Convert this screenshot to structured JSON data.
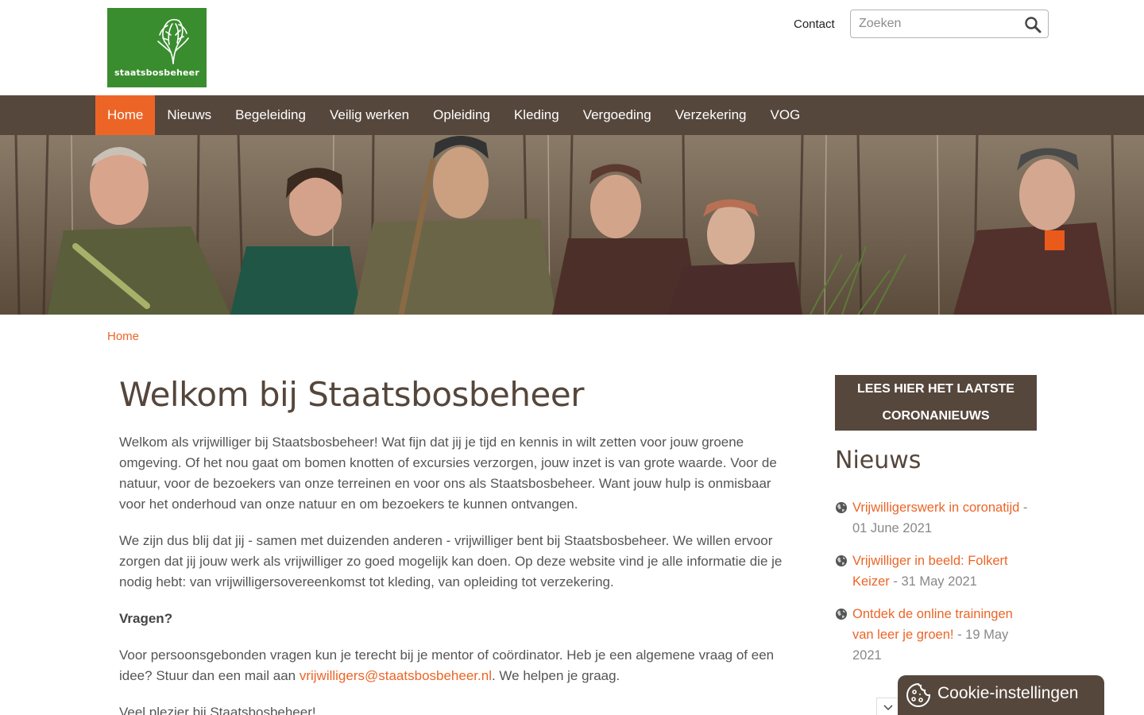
{
  "header": {
    "logo_text": "staatsbosbeheer",
    "contact_label": "Contact",
    "search_placeholder": "Zoeken"
  },
  "nav": {
    "items": [
      "Home",
      "Nieuws",
      "Begeleiding",
      "Veilig werken",
      "Opleiding",
      "Kleding",
      "Vergoeding",
      "Verzekering",
      "VOG"
    ],
    "active": "Home"
  },
  "breadcrumb": "Home",
  "main": {
    "title": "Welkom bij Staatsbosbeheer",
    "p1": "Welkom als vrijwilliger bij Staatsbosbeheer! Wat fijn dat jij je tijd en kennis in wilt zetten voor jouw groene omgeving. Of het nou gaat om bomen knotten of excursies verzorgen, jouw inzet is van grote waarde. Voor de natuur, voor de bezoekers van onze terreinen en voor ons als Staatsbosbeheer. Want jouw hulp is onmisbaar voor het onderhoud van onze natuur en om bezoekers te kunnen ontvangen.",
    "p2": "We zijn dus blij dat jij - samen met duizenden anderen - vrijwilliger bent bij Staatsbosbeheer. We willen ervoor zorgen dat jij jouw werk als vrijwilliger zo goed mogelijk kan doen. Op deze website vind je alle informatie die je nodig hebt: van vrijwilligersovereenkomst tot kleding, van opleiding tot verzekering.",
    "questions_heading": "Vragen?",
    "p3_before": "Voor persoonsgebonden vragen kun je terecht bij je mentor of coördinator. Heb je een algemene vraag of een idee? Stuur dan een mail aan ",
    "p3_email": "vrijwilligers@staatsbosbeheer.nl",
    "p3_after": ". We helpen je graag.",
    "p4": "Veel plezier bij Staatsbosbeheer!"
  },
  "sidebar": {
    "corona_line1": "LEES HIER HET LAATSTE",
    "corona_line2": "CORONANIEUWS",
    "news_heading": "Nieuws",
    "news": [
      {
        "title": "Vrijwilligerswerk in coronatijd",
        "date": "01 June 2021"
      },
      {
        "title": "Vrijwilliger in beeld: Folkert Keizer",
        "date": "31 May 2021"
      },
      {
        "title": "Ontdek de online trainingen van leer je groen!",
        "date": "19 May 2021"
      }
    ]
  },
  "cookie": {
    "label": "Cookie-instellingen"
  },
  "colors": {
    "brand_green": "#3a8d2f",
    "nav_brown": "#56473c",
    "accent_orange": "#ec6527"
  }
}
